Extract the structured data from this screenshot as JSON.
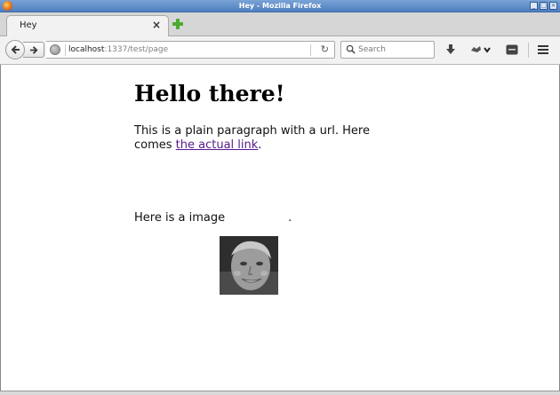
{
  "window": {
    "title": "Hey - Mozilla Firefox",
    "buttons": [
      "_",
      "□",
      "×"
    ]
  },
  "tabs": [
    {
      "label": "Hey",
      "close": "×"
    }
  ],
  "navbar": {
    "url_host": "localhost",
    "url_path": ":1337/test/page",
    "search_placeholder": "Search",
    "reload": "↻"
  },
  "page": {
    "heading": "Hello there!",
    "paragraph_text": "This is a plain paragraph with a url. Here comes ",
    "link_text": "the actual link",
    "paragraph_end": ".",
    "image_line_text": "Here is a image",
    "image_line_end": "."
  },
  "icons": {
    "back": "back-arrow-icon",
    "forward": "forward-arrow-icon",
    "site": "globe-icon",
    "reload": "reload-icon",
    "search": "search-icon",
    "downloads": "download-icon",
    "sync": "sync-icon",
    "devtools": "developer-tools-icon",
    "menu": "hamburger-menu-icon",
    "new_tab": "plus-icon"
  },
  "colors": {
    "titlebar": "#4f7fbf",
    "link_visited": "#551a8b",
    "new_tab_plus": "#4caa2c"
  }
}
